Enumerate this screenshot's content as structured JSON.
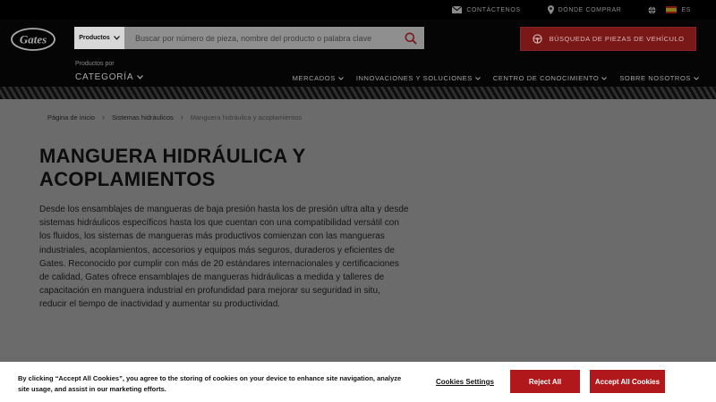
{
  "utility_bar": {
    "contact": "CONTÁCTENOS",
    "where_to_buy": "DÓNDE COMPRAR",
    "language": "ES"
  },
  "header": {
    "logo_text": "Gates",
    "search_category": "Productos",
    "search_placeholder": "Buscar por número de pieza, nombre del producto o palabra clave",
    "vehicle_button": "BÚSQUEDA DE PIEZAS DE VEHÍCULO",
    "products_by": "Productos por",
    "category": "CATEGORÍA",
    "nav": [
      "MERCADOS",
      "INNOVACIONES Y SOLUCIONES",
      "CENTRO DE CONOCIMIENTO",
      "SOBRE NOSOTROS"
    ]
  },
  "breadcrumb": {
    "home": "Página de inicio",
    "parent": "Sistemas hidráulicos",
    "current": "Manguera hidráulica y acoplamientos"
  },
  "content": {
    "title": "MANGUERA HIDRÁULICA Y ACOPLAMIENTOS",
    "description": "Desde los ensamblajes de mangueras de baja presión hasta los de presión ultra alta y desde sistemas hidráulicos específicos hasta los que cuentan con una compatibilidad versátil con los fluidos, los sistemas de mangueras más productivos comienzan con las mangueras industriales, acoplamientos, accesorios y equipos más seguros, duraderos y eficientes de Gates. Reconocido por cumplir con más de 20 estándares internacionales y certificaciones de calidad, Gates ofrece ensamblajes de mangueras hidráulicas a medida y talleres de capacitación en manguera industrial en profundidad para mejorar su seguridad in situ, reducir el tiempo de inactividad y aumentar su productividad."
  },
  "cookie_banner": {
    "text": "By clicking “Accept All Cookies”, you agree to the storing of cookies on your device to enhance site navigation, analyze site usage, and assist in our marketing efforts.",
    "settings": "Cookies Settings",
    "reject": "Reject All",
    "accept": "Accept All Cookies"
  },
  "colors": {
    "brand_red": "#b0181c",
    "header_bg": "#050505",
    "overlay_bg": "#6b6b6b"
  }
}
